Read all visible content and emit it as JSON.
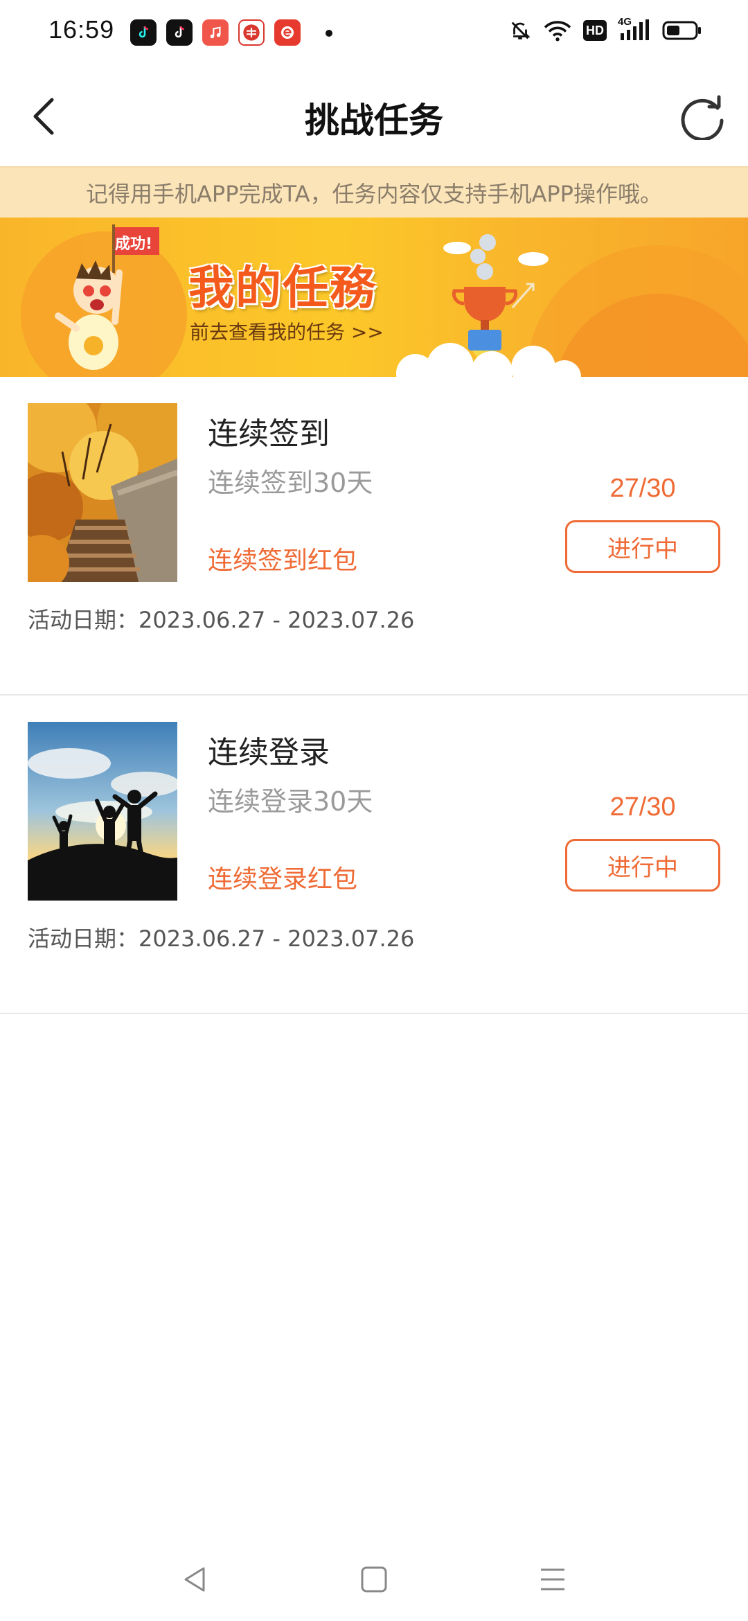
{
  "status_bar": {
    "time": "16:59",
    "app_icons": [
      {
        "name": "douyin-lite-icon",
        "color": "#111111"
      },
      {
        "name": "douyin-icon",
        "color": "#111111"
      },
      {
        "name": "music-app-icon",
        "color": "#f0564a"
      },
      {
        "name": "mall-app-icon",
        "color": "#d9372e"
      },
      {
        "name": "e-app-icon",
        "color": "#e63a2f"
      }
    ],
    "indicators": [
      "mute-icon",
      "wifi-icon",
      "hd-icon",
      "signal-4g-icon",
      "battery-icon"
    ],
    "hd_label": "HD",
    "network_label": "4G"
  },
  "header": {
    "title": "挑战任务"
  },
  "notice": {
    "text": "记得用手机APP完成TA，任务内容仅支持手机APP操作哦。"
  },
  "banner": {
    "badge": "成功!",
    "title": "我的任務",
    "subtitle": "前去查看我的任务 >>"
  },
  "tasks": [
    {
      "name": "连续签到",
      "desc": "连续签到30天",
      "reward": "连续签到红包",
      "progress": "27/30",
      "status": "进行中",
      "date": "活动日期：2023.06.27 - 2023.07.26"
    },
    {
      "name": "连续登录",
      "desc": "连续登录30天",
      "reward": "连续登录红包",
      "progress": "27/30",
      "status": "进行中",
      "date": "活动日期：2023.06.27 - 2023.07.26"
    }
  ],
  "colors": {
    "accent": "#ef6a34",
    "notice_bg": "#fbe5b8",
    "banner_bg": "#fcc829"
  }
}
